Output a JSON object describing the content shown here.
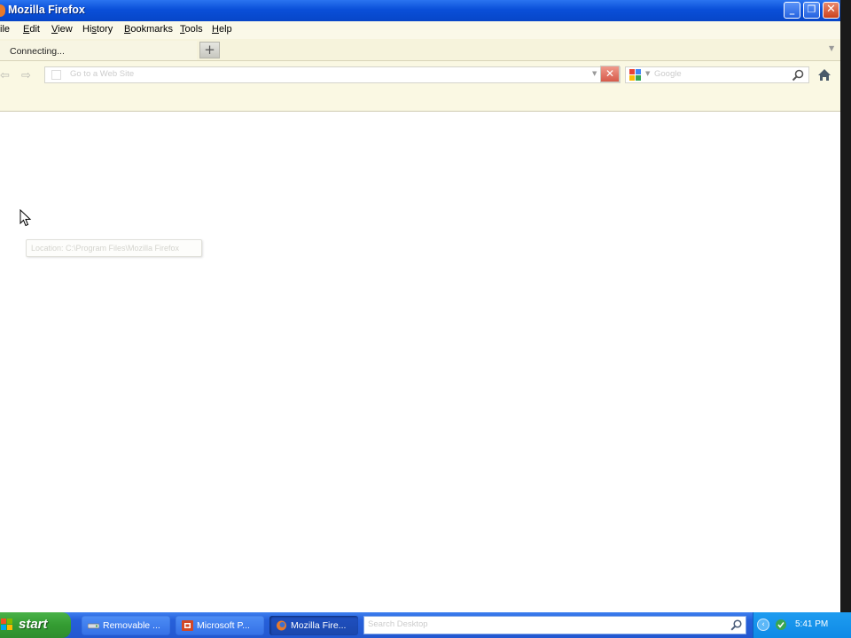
{
  "window": {
    "title": "Mozilla Firefox",
    "controls": {
      "minimize": "_",
      "maximize": "❐",
      "close": "✕"
    }
  },
  "menu": {
    "items": [
      {
        "label": "File",
        "shown": "ile",
        "accel": "F"
      },
      {
        "label": "Edit",
        "accel": "E"
      },
      {
        "label": "View",
        "accel": "V"
      },
      {
        "label": "History",
        "accel": "s"
      },
      {
        "label": "Bookmarks",
        "accel": "B"
      },
      {
        "label": "Tools",
        "accel": "T"
      },
      {
        "label": "Help",
        "accel": "H"
      }
    ]
  },
  "tabs": {
    "active_label": "Connecting...",
    "new_tab_label": "+",
    "list_arrow": "▼"
  },
  "navbar": {
    "back_glyph": "⇦",
    "forward_glyph": "⇨",
    "url_placeholder": "Go to a Web Site",
    "url_value": "",
    "url_dropdown_glyph": "▼",
    "stop_glyph": "✕",
    "search_placeholder": "Google",
    "search_engine_dropdown_glyph": "▼",
    "icons": [
      "back-arrow-icon",
      "forward-arrow-icon",
      "favicon-placeholder-icon",
      "stop-icon",
      "google-icon",
      "magnifier-icon",
      "home-icon"
    ]
  },
  "content": {
    "tooltip_text": "Location: C:\\Program Files\\Mozilla Firefox"
  },
  "taskbar": {
    "start_label": "start",
    "tasks": [
      {
        "label": "Removable ...",
        "icon": "removable-disk-icon",
        "active": false
      },
      {
        "label": "Microsoft P...",
        "icon": "powerpoint-icon",
        "active": false
      },
      {
        "label": "Mozilla Fire...",
        "icon": "firefox-icon",
        "active": true
      }
    ],
    "search_placeholder": "Search Desktop",
    "clock": "5:41 PM"
  },
  "colors": {
    "titlebar": "#0a4fd8",
    "chrome_bg": "#faf8e3",
    "taskbar": "#2358d0",
    "start_green": "#349c32",
    "tray_blue": "#0f8ae6",
    "stop_red": "#d65a4a"
  }
}
